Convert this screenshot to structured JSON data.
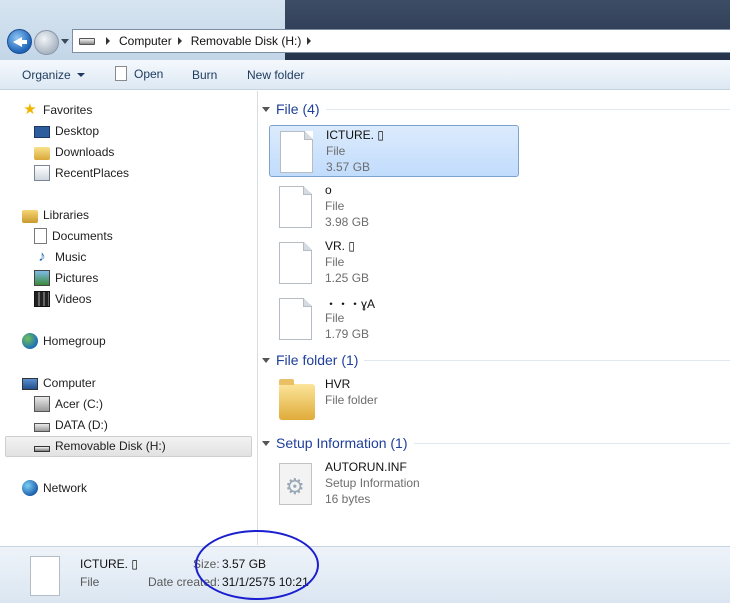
{
  "address": {
    "crumbs": [
      "Computer",
      "Removable Disk (H:)"
    ]
  },
  "toolbar": {
    "organize": "Organize",
    "open": "Open",
    "burn": "Burn",
    "new_folder": "New folder"
  },
  "nav": {
    "favorites": "Favorites",
    "desktop": "Desktop",
    "downloads": "Downloads",
    "recent": "RecentPlaces",
    "libraries": "Libraries",
    "documents": "Documents",
    "music": "Music",
    "pictures": "Pictures",
    "videos": "Videos",
    "homegroup": "Homegroup",
    "computer": "Computer",
    "acer": "Acer (C:)",
    "data": "DATA (D:)",
    "removable": "Removable Disk (H:)",
    "network": "Network"
  },
  "groups": {
    "file": "File (4)",
    "folder": "File folder (1)",
    "setup": "Setup Information (1)"
  },
  "items": [
    {
      "name": "ICTURE. ▯",
      "type": "File",
      "size": "3.57 GB"
    },
    {
      "name": "o",
      "type": "File",
      "size": "3.98 GB"
    },
    {
      "name": "VR. ▯",
      "type": "File",
      "size": "1.25 GB"
    },
    {
      "name": "・・・ɣA",
      "type": "File",
      "size": "1.79 GB"
    },
    {
      "name": "HVR",
      "type": "File folder",
      "size": ""
    },
    {
      "name": "AUTORUN.INF",
      "type": "Setup Information",
      "size": "16 bytes"
    }
  ],
  "details": {
    "name": "ICTURE. ▯",
    "type": "File",
    "size_label": "Size:",
    "size": "3.57 GB",
    "date_label": "Date created:",
    "date": "31/1/2575 10:21"
  },
  "colors": {
    "group_title": "#1e3f9a",
    "selection": "#c1dcfc",
    "annotation": "#1a1fd0"
  }
}
